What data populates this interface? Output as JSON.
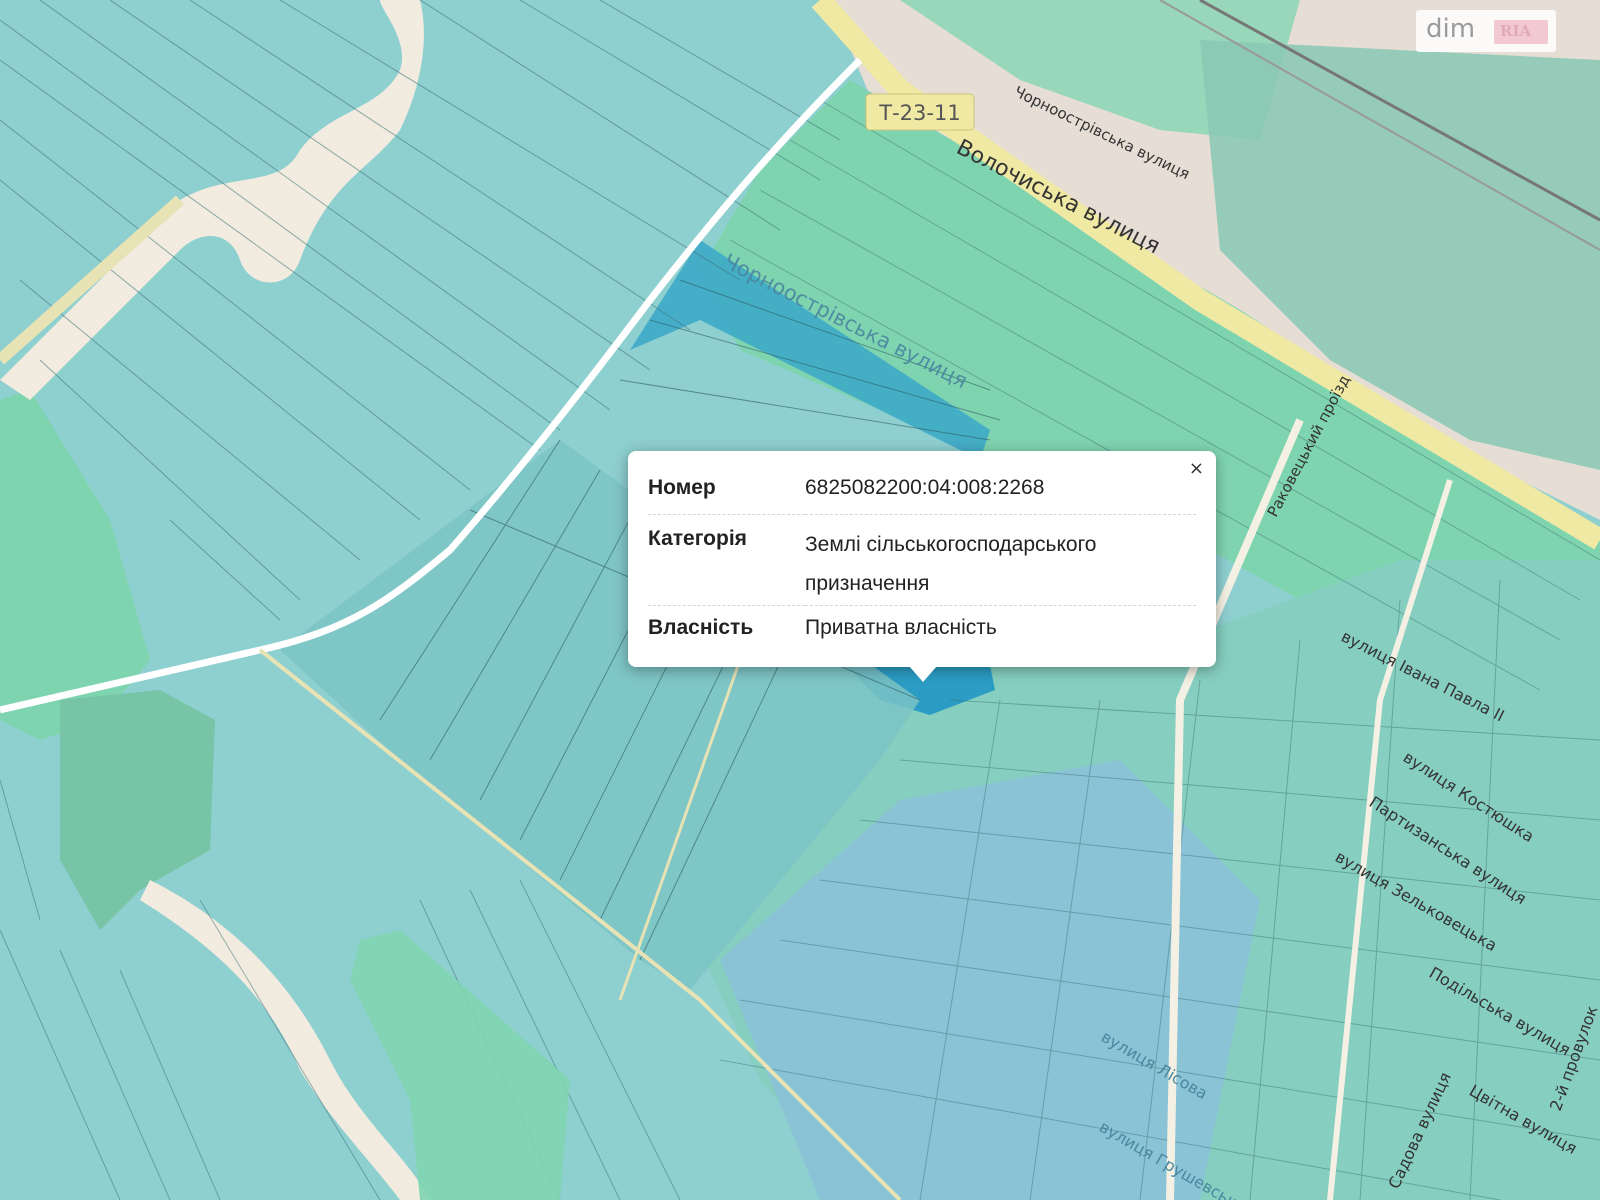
{
  "map": {
    "road_badge": "Т-23-11",
    "street_labels": {
      "volochyska": "Волочиська вулиця",
      "chornoostrivska_north": "Чорноострівська вулиця",
      "chornoostrivska_south": "Чорноострівська вулиця",
      "proizd": "Раковецький проїзд",
      "ivana_pavla": "вулиця Івана Павла ІІ",
      "kostiushka": "вулиця Костюшка",
      "partyzanska": "Партизанська вулиця",
      "zelkovetska": "вулиця Зельковецька",
      "podilska": "Подільська вулиця",
      "sadova": "Садова вулиця",
      "tsvitna": "Цвітна вулиця",
      "druha_proizd": "2-й провулок",
      "lisova": "вулиця Лісова",
      "hrushevskoho": "вулиця Грушевського"
    },
    "colors": {
      "agricultural": "#8ecfd0",
      "residential": "#7fd4b0",
      "selected": "#3aa7c8",
      "road": "#f5f0c8",
      "built": "#e6ded5"
    }
  },
  "popup": {
    "close_label": "×",
    "rows": [
      {
        "key": "Номер",
        "value": "6825082200:04:008:2268"
      },
      {
        "key": "Категорія",
        "value": "Землі сільськогосподарського призначення"
      },
      {
        "key": "Власність",
        "value": "Приватна власність"
      }
    ]
  },
  "watermark": {
    "brand": "dim",
    "badge": "RIA"
  }
}
